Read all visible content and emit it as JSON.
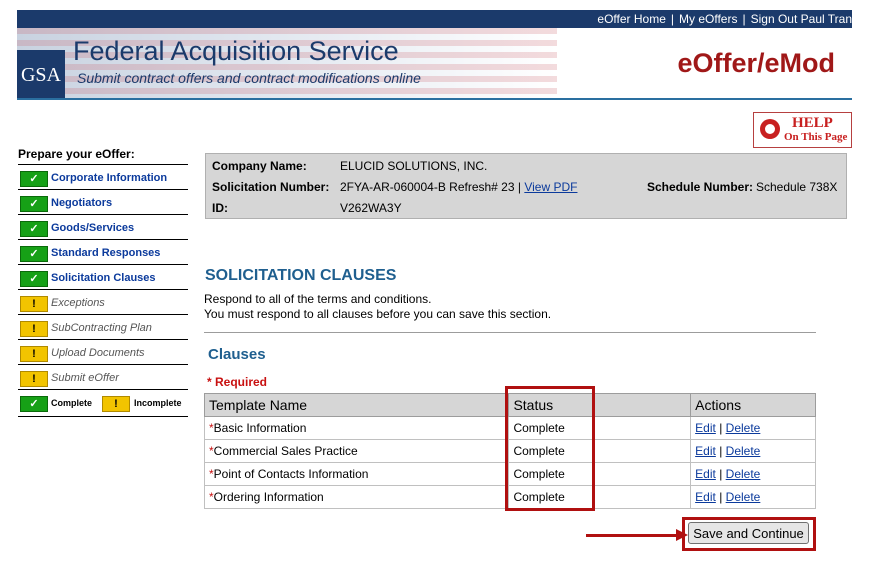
{
  "topnav": {
    "home": "eOffer Home",
    "my_eoffers": "My eOffers",
    "signout": "Sign Out Paul Tran",
    "separator": "|"
  },
  "banner": {
    "logo": "GSA",
    "title": "Federal Acquisition Service",
    "subtitle": "Submit contract offers and contract modifications online",
    "app_title": "eOffer/eMod"
  },
  "help": {
    "main": "HELP",
    "sub": "On This Page"
  },
  "sidebar": {
    "heading": "Prepare your eOffer:",
    "items": [
      {
        "label": "Corporate Information",
        "status": "complete"
      },
      {
        "label": "Negotiators",
        "status": "complete"
      },
      {
        "label": "Goods/Services",
        "status": "complete"
      },
      {
        "label": "Standard Responses",
        "status": "complete"
      },
      {
        "label": "Solicitation Clauses",
        "status": "complete"
      },
      {
        "label": "Exceptions",
        "status": "incomplete"
      },
      {
        "label": "SubContracting Plan",
        "status": "incomplete"
      },
      {
        "label": "Upload Documents",
        "status": "incomplete"
      },
      {
        "label": "Submit eOffer",
        "status": "incomplete"
      }
    ],
    "legend": {
      "complete": "Complete",
      "incomplete": "Incomplete",
      "check_glyph": "✓",
      "bang_glyph": "!"
    }
  },
  "info": {
    "company_label": "Company Name:",
    "company_value": "ELUCID SOLUTIONS, INC.",
    "solicitation_label": "Solicitation Number:",
    "solicitation_value": "2FYA-AR-060004-B Refresh# 23 |",
    "view_pdf": "View PDF",
    "schedule_label": "Schedule Number:",
    "schedule_value": "Schedule 738X",
    "id_label": "ID:",
    "id_value": "V262WA3Y"
  },
  "section": {
    "title": "SOLICITATION CLAUSES",
    "desc_1": "Respond to all of the terms and conditions.",
    "desc_2": "You must respond to all clauses before you can save this section."
  },
  "clauses": {
    "title": "Clauses",
    "required": "* Required",
    "headers": {
      "template": "Template Name",
      "status": "Status",
      "actions": "Actions"
    },
    "rows": [
      {
        "name": "Basic Information",
        "status": "Complete",
        "edit": "Edit",
        "delete": "Delete"
      },
      {
        "name": "Commercial Sales Practice",
        "status": "Complete",
        "edit": "Edit",
        "delete": "Delete"
      },
      {
        "name": "Point of Contacts Information",
        "status": "Complete",
        "edit": "Edit",
        "delete": "Delete"
      },
      {
        "name": "Ordering Information",
        "status": "Complete",
        "edit": "Edit",
        "delete": "Delete"
      }
    ],
    "star": "*",
    "action_sep": "|"
  },
  "save_button": "Save and Continue",
  "colors": {
    "navy": "#1b3a6b",
    "brand_red": "#a01818",
    "link_blue": "#0b3a9c",
    "section_blue": "#1f5f8f",
    "highlight_red": "#b01010",
    "complete_green": "#16a016",
    "incomplete_yellow": "#f2c400"
  }
}
